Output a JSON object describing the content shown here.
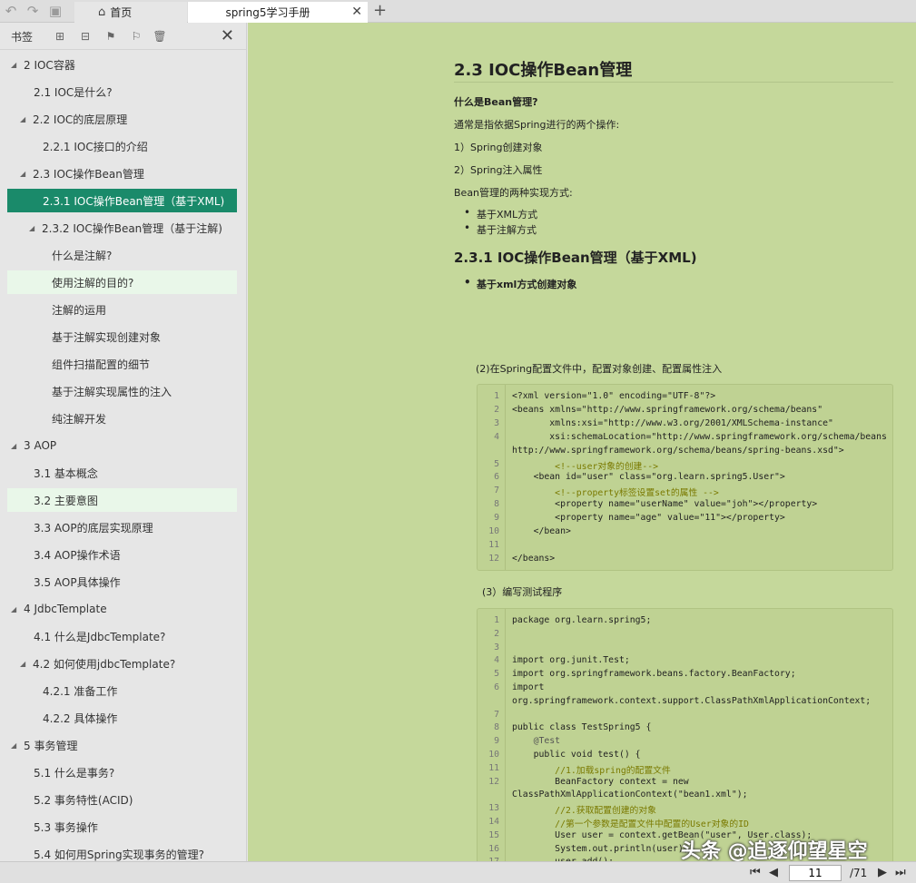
{
  "toolbar": {
    "undo": "↶",
    "redo": "↷",
    "save": "▣",
    "tabs": [
      {
        "label": "首页"
      },
      {
        "label": "spring5学习手册"
      }
    ],
    "add": "+",
    "close": "✕"
  },
  "sidebar": {
    "title": "书签",
    "close": "✕",
    "items": [
      {
        "label": "2 IOC容器",
        "expanded": true
      },
      {
        "label": "2.1 IOC是什么?"
      },
      {
        "label": "2.2 IOC的底层原理",
        "expanded": true
      },
      {
        "label": "2.2.1 IOC接口的介绍"
      },
      {
        "label": "2.3 IOC操作Bean管理",
        "expanded": true
      },
      {
        "label": "2.3.1 IOC操作Bean管理（基于XML)",
        "selected": true
      },
      {
        "label": "2.3.2 IOC操作Bean管理（基于注解)",
        "expanded": true
      },
      {
        "label": "什么是注解?"
      },
      {
        "label": "使用注解的目的?"
      },
      {
        "label": "注解的运用"
      },
      {
        "label": "基于注解实现创建对象"
      },
      {
        "label": "组件扫描配置的细节"
      },
      {
        "label": "基于注解实现属性的注入"
      },
      {
        "label": "纯注解开发"
      },
      {
        "label": "3 AOP",
        "expanded": true
      },
      {
        "label": "3.1 基本概念"
      },
      {
        "label": "3.2 主要意图"
      },
      {
        "label": "3.3 AOP的底层实现原理"
      },
      {
        "label": "3.4 AOP操作术语"
      },
      {
        "label": "3.5 AOP具体操作"
      },
      {
        "label": "4 JdbcTemplate",
        "expanded": true
      },
      {
        "label": "4.1 什么是JdbcTemplate?"
      },
      {
        "label": "4.2 如何使用jdbcTemplate?",
        "expanded": true
      },
      {
        "label": "4.2.1 准备工作"
      },
      {
        "label": "4.2.2 具体操作"
      },
      {
        "label": "5 事务管理",
        "expanded": true
      },
      {
        "label": "5.1 什么是事务?"
      },
      {
        "label": "5.2 事务特性(ACID)"
      },
      {
        "label": "5.3 事务操作"
      },
      {
        "label": "5.4 如何用Spring实现事务的管理?"
      }
    ]
  },
  "doc": {
    "h2": "2.3 IOC操作Bean管理",
    "q1": "什么是Bean管理?",
    "p1": "通常是指依据Spring进行的两个操作:",
    "p2": "1）Spring创建对象",
    "p3": "2）Spring注入属性",
    "p4": "Bean管理的两种实现方式:",
    "b1": "基于XML方式",
    "b2": "基于注解方式",
    "h3": "2.3.1 IOC操作Bean管理（基于XML)",
    "b3": "基于xml方式创建对象",
    "p5": "(2)在Spring配置文件中，配置对象创建、配置属性注入",
    "p6": "(3）编写测试程序"
  },
  "code1": [
    {
      "n": "1",
      "t": "<?xml version=\"1.0\" encoding=\"UTF-8\"?>"
    },
    {
      "n": "2",
      "t": "<beans xmlns=\"http://www.springframework.org/schema/beans\""
    },
    {
      "n": "3",
      "t": "       xmlns:xsi=\"http://www.w3.org/2001/XMLSchema-instance\""
    },
    {
      "n": "4",
      "t": "       xsi:schemaLocation=\"http://www.springframework.org/schema/beans"
    },
    {
      "n": "",
      "t": "http://www.springframework.org/schema/beans/spring-beans.xsd\">"
    },
    {
      "n": "5",
      "t": "        <!--user对象的创建-->"
    },
    {
      "n": "6",
      "t": "    <bean id=\"user\" class=\"org.learn.spring5.User\">"
    },
    {
      "n": "7",
      "t": "        <!--property标签设置set的属性 -->"
    },
    {
      "n": "8",
      "t": "        <property name=\"userName\" value=\"joh\"></property>"
    },
    {
      "n": "9",
      "t": "        <property name=\"age\" value=\"11\"></property>"
    },
    {
      "n": "10",
      "t": "    </bean>"
    },
    {
      "n": "11",
      "t": ""
    },
    {
      "n": "12",
      "t": "</beans>"
    }
  ],
  "code2": [
    {
      "n": "1",
      "t": "package org.learn.spring5;"
    },
    {
      "n": "2",
      "t": ""
    },
    {
      "n": "3",
      "t": ""
    },
    {
      "n": "4",
      "t": "import org.junit.Test;"
    },
    {
      "n": "5",
      "t": "import org.springframework.beans.factory.BeanFactory;"
    },
    {
      "n": "6",
      "t": "import"
    },
    {
      "n": "",
      "t": "org.springframework.context.support.ClassPathXmlApplicationContext;"
    },
    {
      "n": "7",
      "t": ""
    },
    {
      "n": "8",
      "t": "public class TestSpring5 {"
    },
    {
      "n": "9",
      "t": "    @Test"
    },
    {
      "n": "10",
      "t": "    public void test() {"
    },
    {
      "n": "11",
      "t": "        //1.加载spring的配置文件"
    },
    {
      "n": "12",
      "t": "        BeanFactory context = new"
    },
    {
      "n": "",
      "t": "ClassPathXmlApplicationContext(\"bean1.xml\");"
    },
    {
      "n": "13",
      "t": "        //2.获取配置创建的对象"
    },
    {
      "n": "14",
      "t": "        //第一个参数是配置文件中配置的User对象的ID"
    },
    {
      "n": "15",
      "t": "        User user = context.getBean(\"user\", User.class);"
    },
    {
      "n": "16",
      "t": "        System.out.println(user);"
    },
    {
      "n": "17",
      "t": "        user.add();"
    }
  ],
  "watermark": "头条 @追逐仰望星空",
  "pager": {
    "current": "11",
    "total": "/71"
  }
}
